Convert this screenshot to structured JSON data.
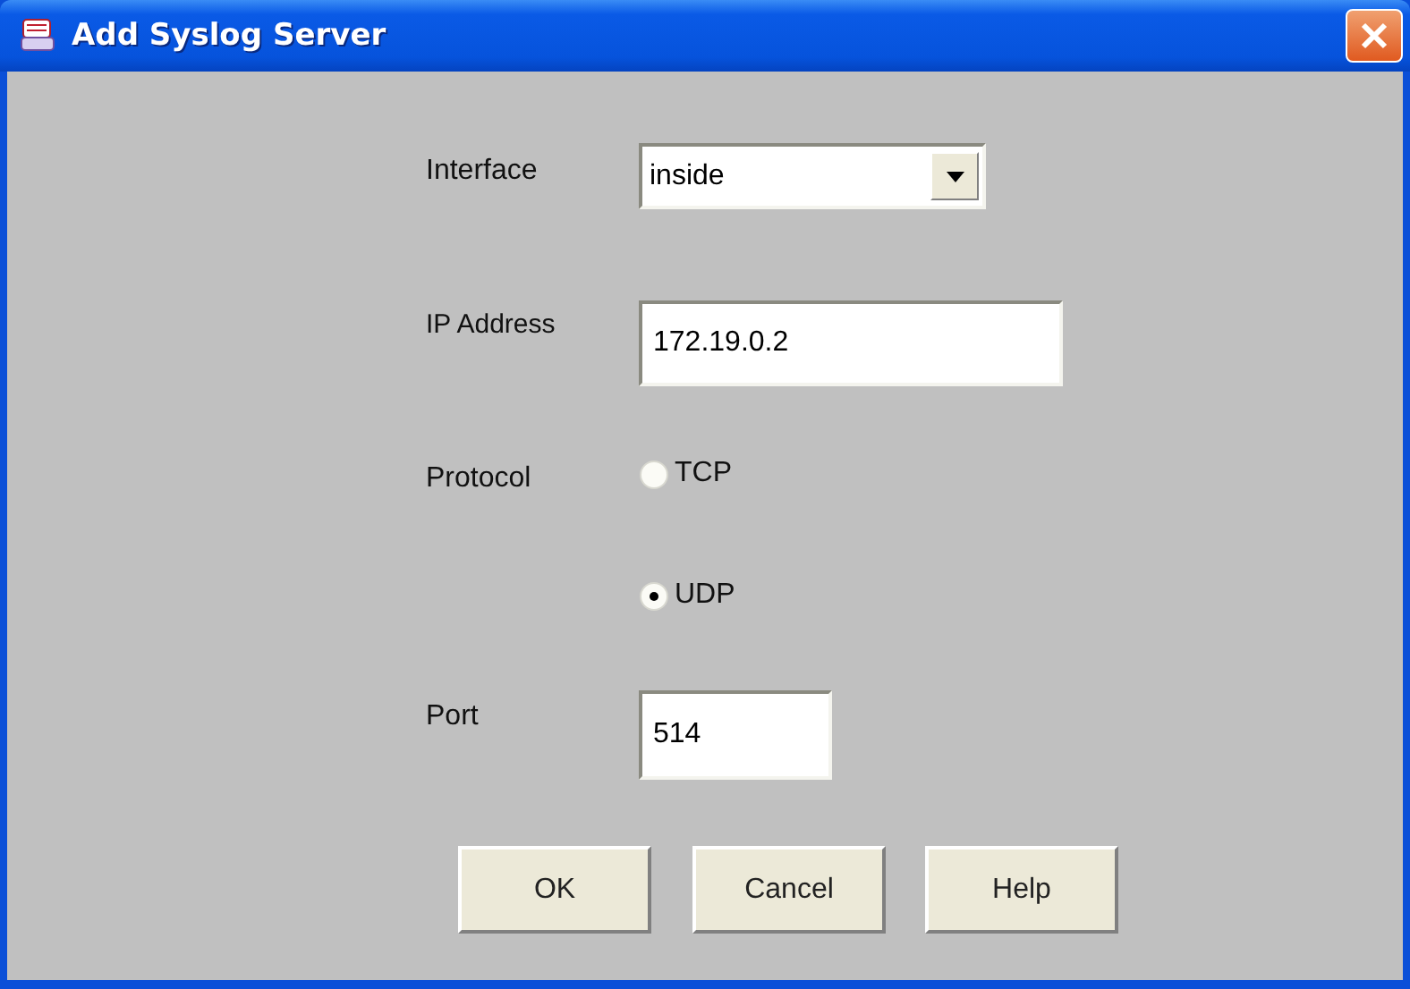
{
  "window": {
    "title": "Add Syslog Server"
  },
  "interface": {
    "label": "Interface",
    "value": "inside"
  },
  "ip_address": {
    "label": "IP Address",
    "value": "172.19.0.2"
  },
  "protocol": {
    "label": "Protocol",
    "options": [
      {
        "label": "TCP",
        "selected": false
      },
      {
        "label": "UDP",
        "selected": true
      }
    ]
  },
  "port": {
    "label": "Port",
    "value": "514"
  },
  "buttons": [
    "OK",
    "Cancel",
    "Help"
  ]
}
